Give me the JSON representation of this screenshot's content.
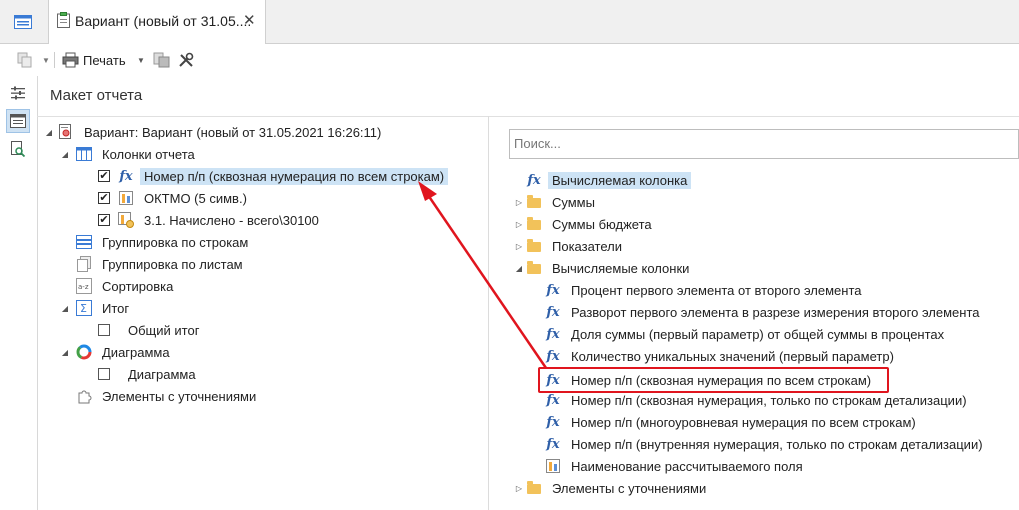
{
  "tab": {
    "title": "Вариант (новый от 31.05....",
    "close": "✕"
  },
  "toolbar": {
    "print_label": "Печать"
  },
  "panel": {
    "title": "Макет отчета"
  },
  "left_tree": {
    "root": "Вариант: Вариант (новый от 31.05.2021 16:26:11)",
    "columns_group": "Колонки отчета",
    "columns": [
      "Номер п/п (сквозная нумерация по всем строкам)",
      "ОКТМО (5 симв.)",
      "3.1. Начислено - всего\\30100"
    ],
    "row_grouping": "Группировка по строкам",
    "sheet_grouping": "Группировка по листам",
    "sorting": "Сортировка",
    "totals": "Итог",
    "grand_total": "Общий итог",
    "diagram_group": "Диаграмма",
    "diagram_item": "Диаграмма",
    "refinements": "Элементы с уточнениями"
  },
  "search": {
    "placeholder": "Поиск..."
  },
  "right_tree": {
    "computed_column": "Вычисляемая колонка",
    "sums": "Суммы",
    "budget_sums": "Суммы бюджета",
    "indicators": "Показатели",
    "computed_columns": "Вычисляемые колонки",
    "computed_items": [
      "Процент первого элемента от второго элемента",
      "Разворот первого элемента в разрезе измерения второго элемента",
      "Доля суммы (первый параметр) от общей суммы в процентах",
      "Количество уникальных значений (первый параметр)",
      "Номер п/п (сквозная нумерация по всем строкам)",
      "Номер п/п (сквозная нумерация, только по строкам детализации)",
      "Номер п/п (многоуровневая нумерация по всем строкам)",
      "Номер п/п (внутренняя нумерация, только по строкам детализации)"
    ],
    "calc_field_name": "Наименование рассчитываемого поля",
    "refinements": "Элементы с уточнениями"
  },
  "colors": {
    "accent": "#2f5fa8",
    "selection": "#cde3f5",
    "annotation": "#e0151e",
    "folder": "#f2c25a"
  }
}
